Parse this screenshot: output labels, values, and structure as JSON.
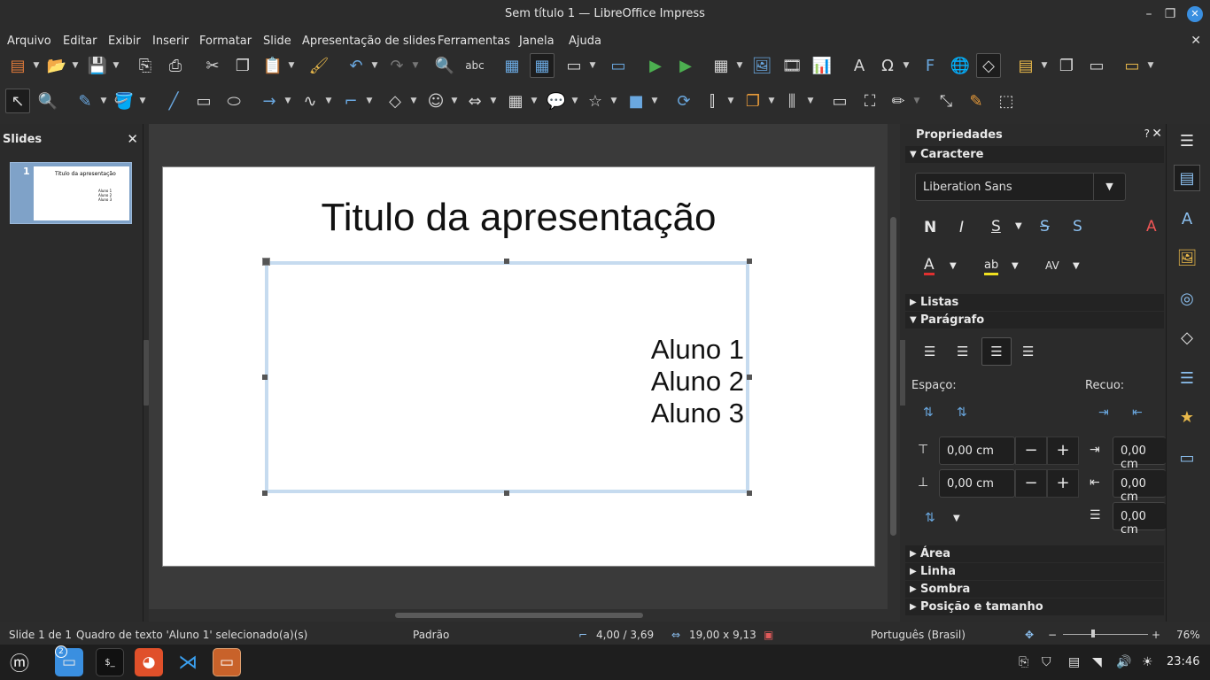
{
  "window": {
    "title": "Sem título 1 — LibreOffice Impress"
  },
  "menu": [
    "Arquivo",
    "Editar",
    "Exibir",
    "Inserir",
    "Formatar",
    "Slide",
    "Apresentação de slides",
    "Ferramentas",
    "Janela",
    "Ajuda"
  ],
  "slides_panel": {
    "title": "Slides",
    "thumb_number": "1",
    "thumb_title": "Titulo da apresentação",
    "thumb_lines": "Aluno 1\nAluno 2\nAluno 3"
  },
  "slide": {
    "title": "Titulo da apresentação",
    "lines": [
      "Aluno 1",
      "Aluno 2",
      "Aluno 3"
    ]
  },
  "sidebar": {
    "title": "Propriedades",
    "help": "?",
    "sections": {
      "caractere": "Caractere",
      "listas": "Listas",
      "paragrafo": "Parágrafo",
      "area": "Área",
      "linha": "Linha",
      "sombra": "Sombra",
      "posicao": "Posição e tamanho"
    },
    "font_name": "Liberation Sans",
    "espaco_label": "Espaço:",
    "recuo_label": "Recuo:",
    "spacing_above": "0,00 cm",
    "spacing_below": "0,00 cm",
    "indent_before": "0,00 cm",
    "indent_after": "0,00 cm",
    "indent_first": "0,00 cm"
  },
  "status": {
    "slide": "Slide 1 de 1",
    "selection": "Quadro de texto 'Aluno 1' selecionado(a)(s)",
    "layout": "Padrão",
    "position": "4,00 / 3,69",
    "size": "19,00 x 9,13",
    "language": "Português (Brasil)",
    "zoom": "76%"
  },
  "taskbar": {
    "files_badge": "2",
    "terminal_label": "$_",
    "clock": "23:46"
  },
  "colors": {
    "selection_accent": "#c6dbef",
    "close_button": "#3a8fe0",
    "deck_icon": "#8cc0f0"
  }
}
